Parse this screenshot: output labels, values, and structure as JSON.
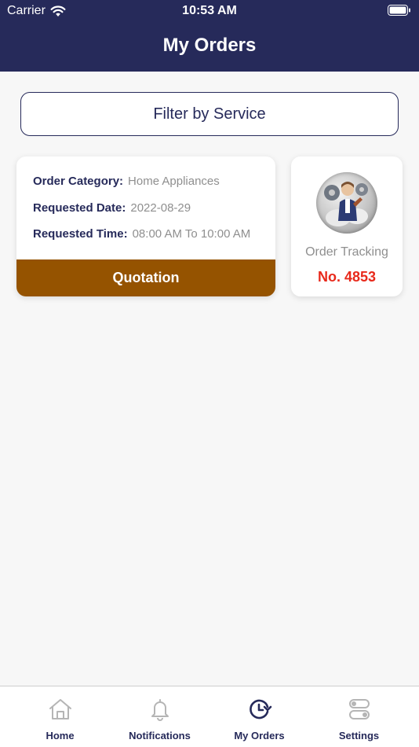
{
  "status_bar": {
    "carrier": "Carrier",
    "time": "10:53 AM"
  },
  "header": {
    "title": "My Orders"
  },
  "filter": {
    "label": "Filter by Service"
  },
  "order": {
    "category_label": "Order Category:",
    "category_value": "Home Appliances",
    "date_label": "Requested Date:",
    "date_value": "2022-08-29",
    "time_label": "Requested Time:",
    "time_value": "08:00 AM To 10:00 AM",
    "action_label": "Quotation"
  },
  "tracking": {
    "label": "Order Tracking",
    "number": "No. 4853"
  },
  "tabbar": {
    "items": [
      {
        "label": "Home",
        "icon": "home-icon"
      },
      {
        "label": "Notifications",
        "icon": "bell-icon"
      },
      {
        "label": "My Orders",
        "icon": "orders-clock-icon"
      },
      {
        "label": "Settings",
        "icon": "settings-toggle-icon"
      }
    ],
    "active": "My Orders"
  },
  "colors": {
    "header_bg": "#262a5a",
    "accent_brown": "#955300",
    "tracking_red": "#e8291b",
    "inactive_icon": "#b5b5b5"
  }
}
